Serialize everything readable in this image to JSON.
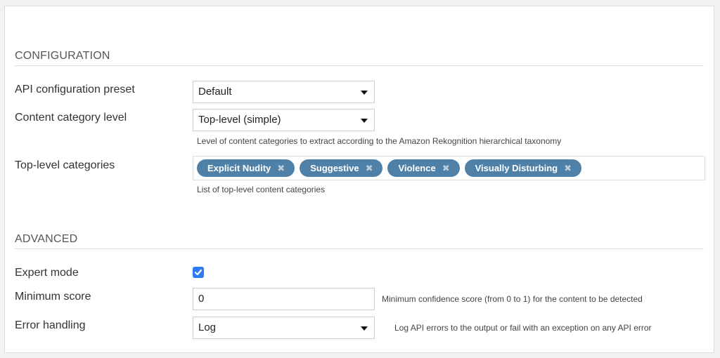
{
  "configuration": {
    "title": "CONFIGURATION",
    "api_preset": {
      "label": "API configuration preset",
      "value": "Default"
    },
    "category_level": {
      "label": "Content category level",
      "value": "Top-level (simple)",
      "help": "Level of content categories to extract according to the Amazon Rekognition hierarchical taxonomy"
    },
    "top_level_categories": {
      "label": "Top-level categories",
      "tags": [
        {
          "label": "Explicit Nudity",
          "remove_icon": "✖"
        },
        {
          "label": "Suggestive",
          "remove_icon": "✖"
        },
        {
          "label": "Violence",
          "remove_icon": "✖"
        },
        {
          "label": "Visually Disturbing",
          "remove_icon": "✖"
        }
      ],
      "help": "List of top-level content categories"
    }
  },
  "advanced": {
    "title": "ADVANCED",
    "expert_mode": {
      "label": "Expert mode",
      "checked": true
    },
    "minimum_score": {
      "label": "Minimum score",
      "value": "0",
      "help": "Minimum confidence score (from 0 to 1) for the content to be detected"
    },
    "error_handling": {
      "label": "Error handling",
      "value": "Log",
      "help": "Log API errors to the output or fail with an exception on any API error"
    }
  },
  "colors": {
    "tag_background": "#4e80a8",
    "checkbox_accent": "#2f7bf5"
  }
}
